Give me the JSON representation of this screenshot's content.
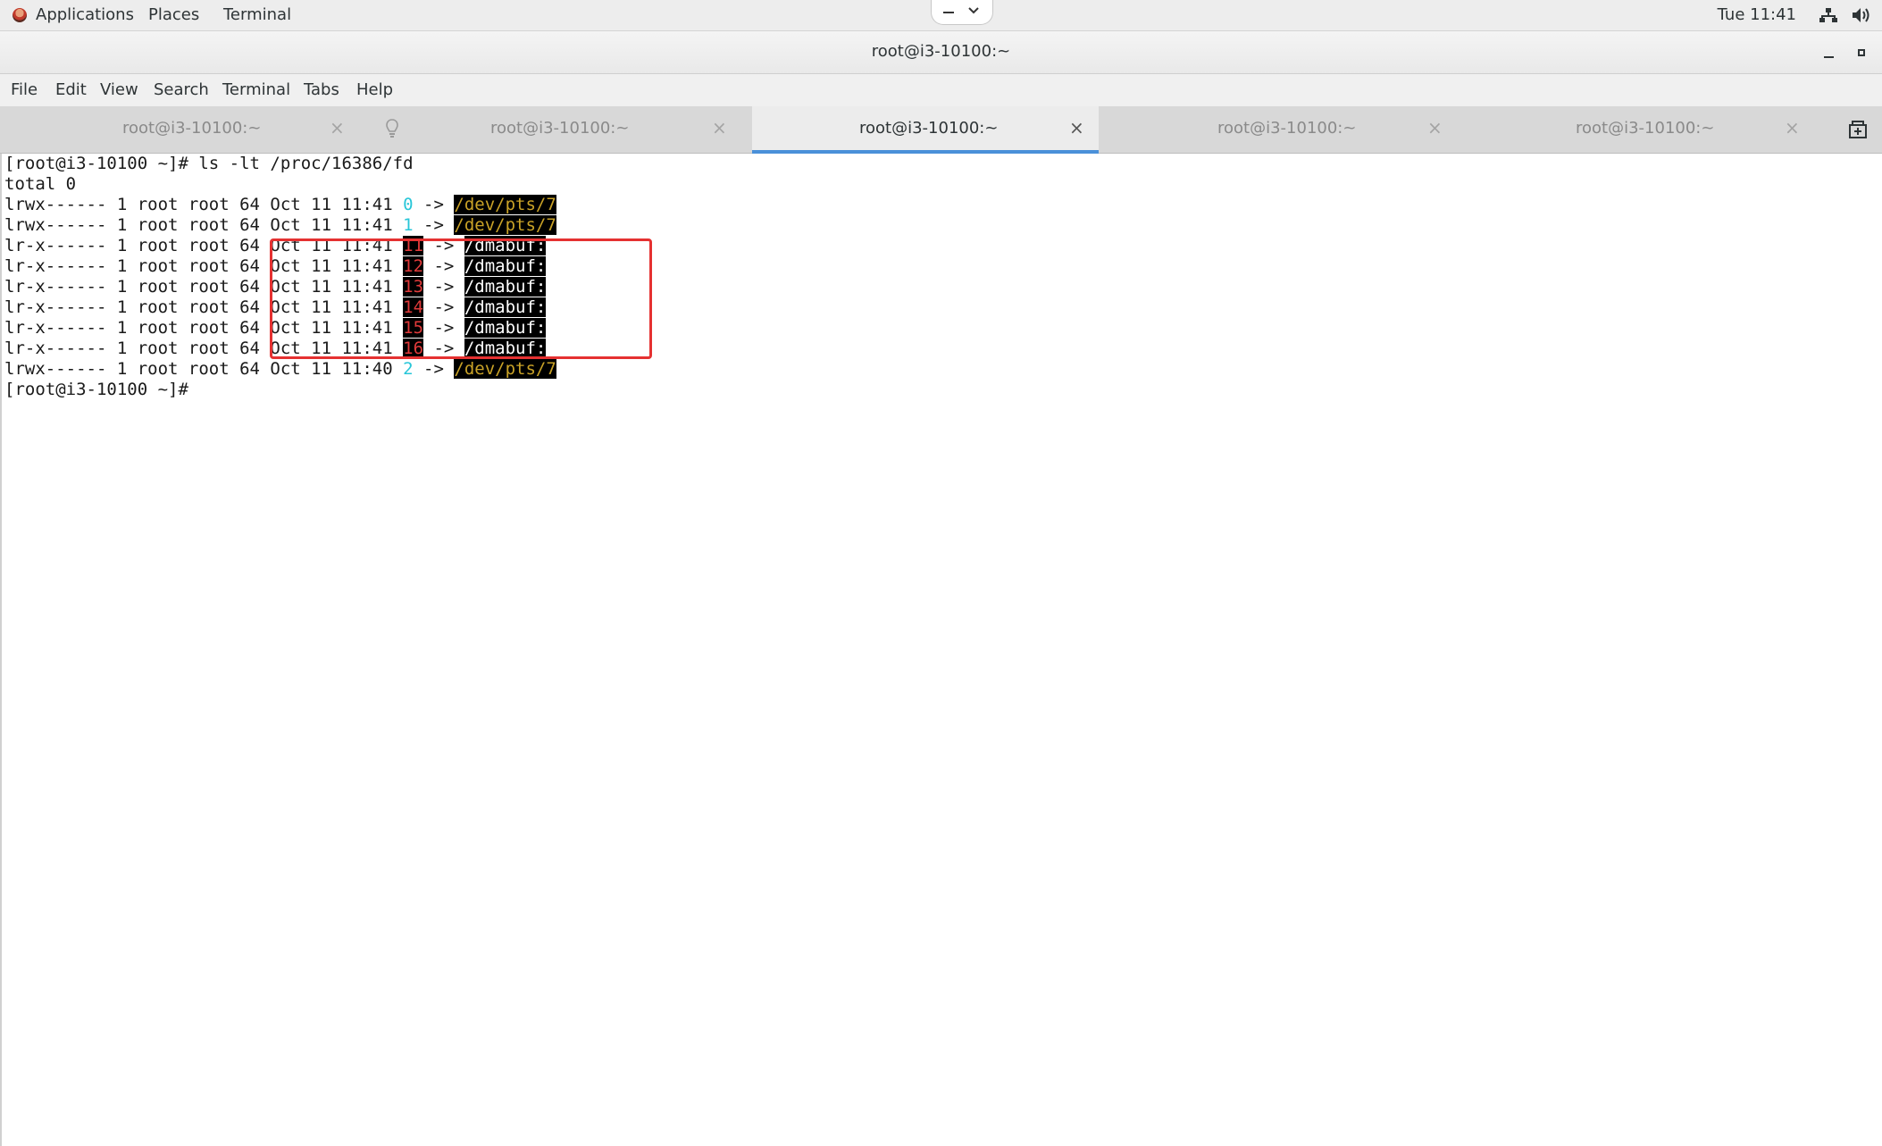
{
  "topbar": {
    "applications": "Applications",
    "places": "Places",
    "terminal": "Terminal",
    "clock": "Tue 11:41"
  },
  "window": {
    "title": "root@i3-10100:~"
  },
  "menubar": {
    "items": [
      "File",
      "Edit",
      "View",
      "Search",
      "Terminal",
      "Tabs",
      "Help"
    ]
  },
  "tabs": [
    {
      "label": "root@i3-10100:~",
      "active": false
    },
    {
      "label": "root@i3-10100:~",
      "active": false
    },
    {
      "label": "root@i3-10100:~",
      "active": true
    },
    {
      "label": "root@i3-10100:~",
      "active": false
    },
    {
      "label": "root@i3-10100:~",
      "active": false
    }
  ],
  "terminal": {
    "command_line": "[root@i3-10100 ~]# ls -lt /proc/16386/fd",
    "total": "total 0",
    "entries": [
      {
        "meta": "lrwx------ 1 root root 64 ",
        "date": "Oct 11 11:41",
        "fd": "0",
        "arrow": " -> ",
        "target": "/dev/pts/7"
      },
      {
        "meta": "lrwx------ 1 root root 64 ",
        "date": "Oct 11 11:41",
        "fd": "1",
        "arrow": " -> ",
        "target": "/dev/pts/7"
      },
      {
        "meta": "lr-x------ 1 root root 64 ",
        "date": "Oct 11 11:41",
        "fd": "11",
        "arrow": " -> ",
        "target": "/dmabuf:"
      },
      {
        "meta": "lr-x------ 1 root root 64 ",
        "date": "Oct 11 11:41",
        "fd": "12",
        "arrow": " -> ",
        "target": "/dmabuf:"
      },
      {
        "meta": "lr-x------ 1 root root 64 ",
        "date": "Oct 11 11:41",
        "fd": "13",
        "arrow": " -> ",
        "target": "/dmabuf:"
      },
      {
        "meta": "lr-x------ 1 root root 64 ",
        "date": "Oct 11 11:41",
        "fd": "14",
        "arrow": " -> ",
        "target": "/dmabuf:"
      },
      {
        "meta": "lr-x------ 1 root root 64 ",
        "date": "Oct 11 11:41",
        "fd": "15",
        "arrow": " -> ",
        "target": "/dmabuf:"
      },
      {
        "meta": "lr-x------ 1 root root 64 ",
        "date": "Oct 11 11:41",
        "fd": "16",
        "arrow": " -> ",
        "target": "/dmabuf:"
      },
      {
        "meta": "lrwx------ 1 root root 64 ",
        "date": "Oct 11 11:40",
        "fd": "2",
        "arrow": " -> ",
        "target": "/dev/pts/7"
      }
    ],
    "prompt": "[root@i3-10100 ~]#"
  },
  "colors": {
    "fd_cyan": "#27c6d8",
    "fd_red": "#e03a3a",
    "pts_target": "#c9a227",
    "highlight_box": "#e53131",
    "active_tab_underline": "#4a90d9"
  },
  "icons": {
    "app": "gnome-foot-icon",
    "network": "network-wired-icon",
    "volume": "audio-volume-icon",
    "tab_close": "close-icon",
    "bell": "bell-icon",
    "new_tab": "new-tab-icon"
  }
}
